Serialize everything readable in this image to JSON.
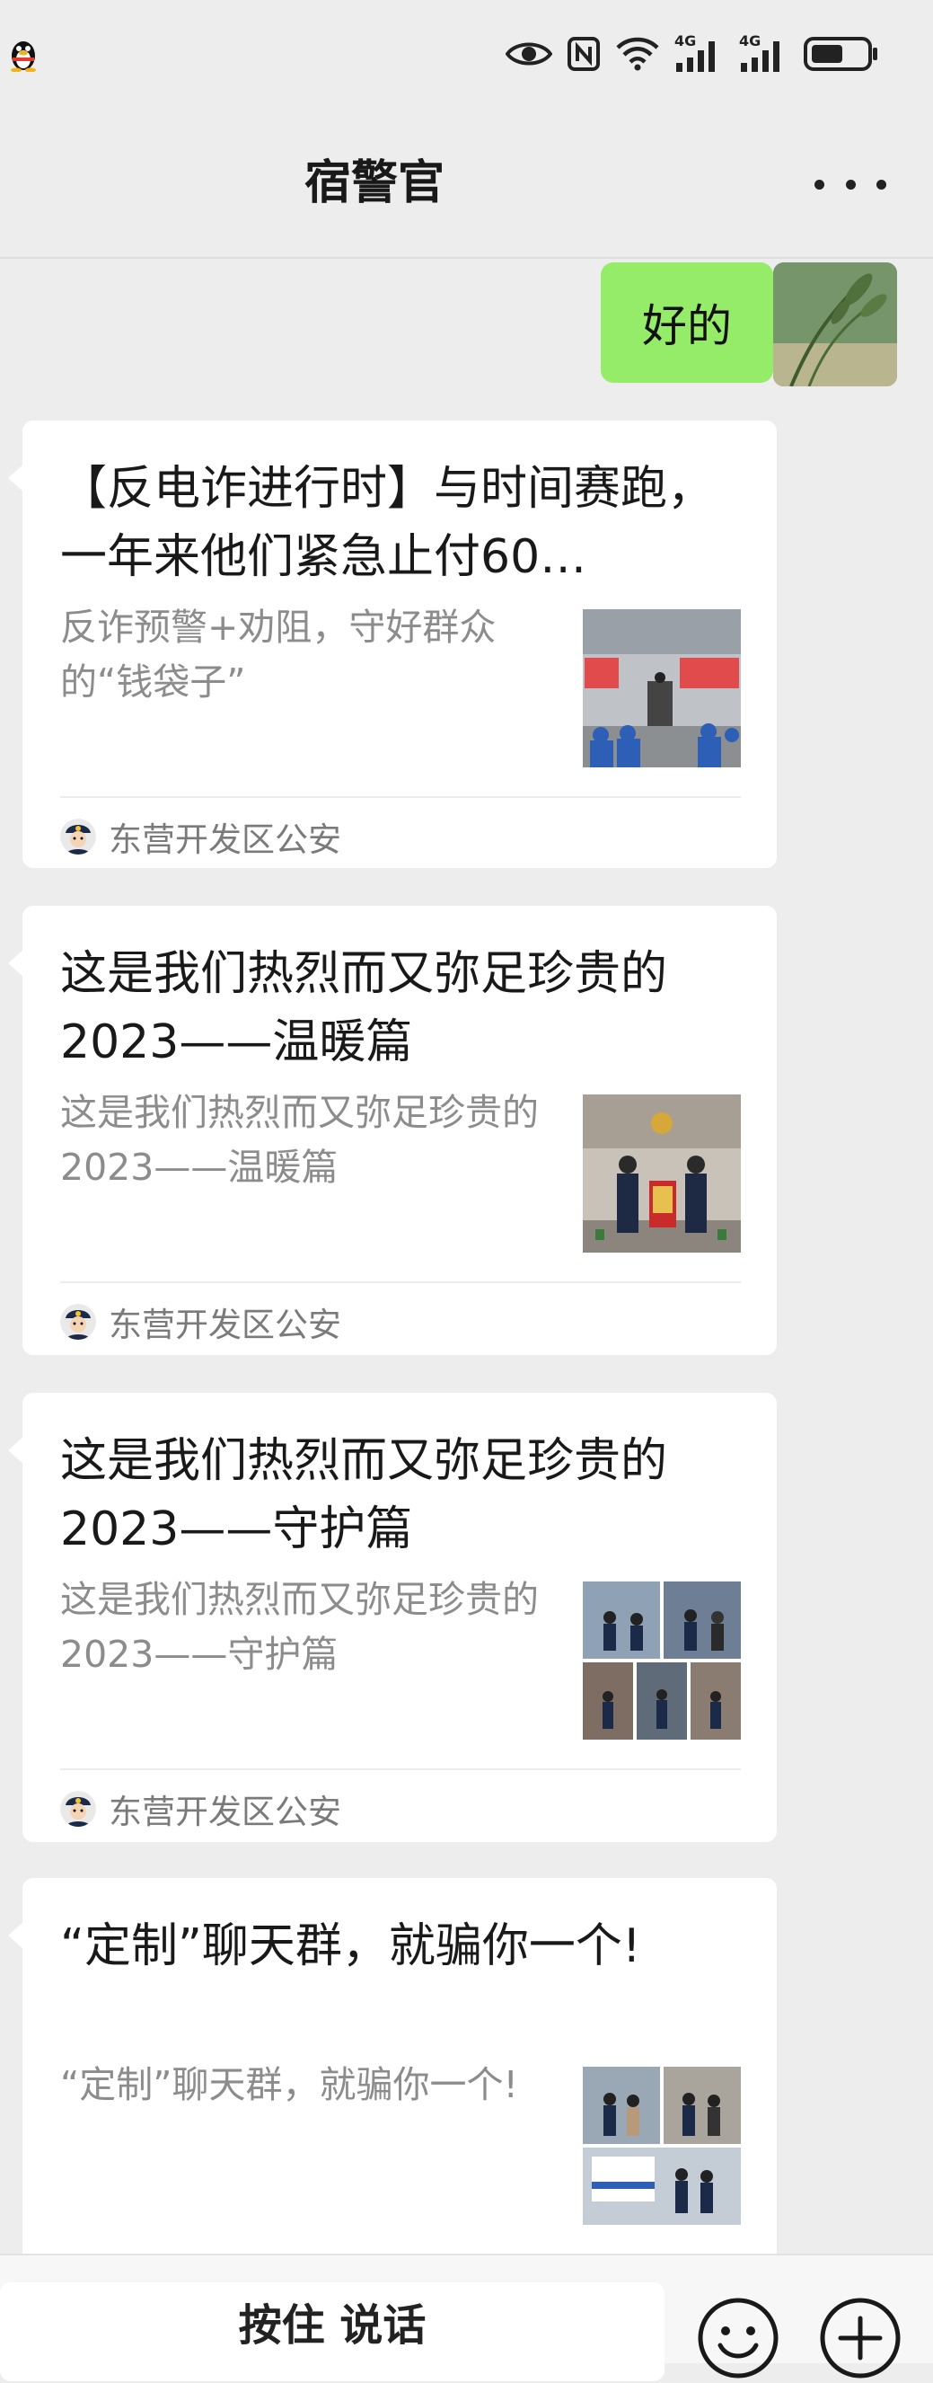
{
  "status_bar": {
    "app_icon": "qq-penguin-icon",
    "icons": [
      "eye-icon",
      "nfc-icon",
      "wifi-icon",
      "signal-4g-icon",
      "signal-4g-icon",
      "battery-icon"
    ],
    "net_label_1": "4G",
    "net_label_2": "4G"
  },
  "header": {
    "title": "宿警官",
    "more_icon": "more-dots-icon"
  },
  "chat": {
    "sent_message": "好的",
    "articles": [
      {
        "title": "【反电诈进行时】与时间赛跑，一年来他们紧急止付60…",
        "desc": "反诈预警+劝阻，守好群众的“钱袋子”",
        "source": "东营开发区公安"
      },
      {
        "title": "这是我们热烈而又弥足珍贵的2023——温暖篇",
        "desc": "这是我们热烈而又弥足珍贵的2023——温暖篇",
        "source": "东营开发区公安"
      },
      {
        "title": "这是我们热烈而又弥足珍贵的2023——守护篇",
        "desc": "这是我们热烈而又弥足珍贵的2023——守护篇",
        "source": "东营开发区公安"
      },
      {
        "title": "“定制”聊天群，就骗你一个!",
        "desc": "“定制”聊天群，就骗你一个!",
        "source": ""
      }
    ]
  },
  "input_bar": {
    "hold_to_talk": "按住 说话",
    "emoji_icon": "emoji-icon",
    "plus_icon": "plus-icon"
  },
  "colors": {
    "background": "#ededed",
    "sent_bubble": "#95ec69",
    "card": "#ffffff"
  }
}
